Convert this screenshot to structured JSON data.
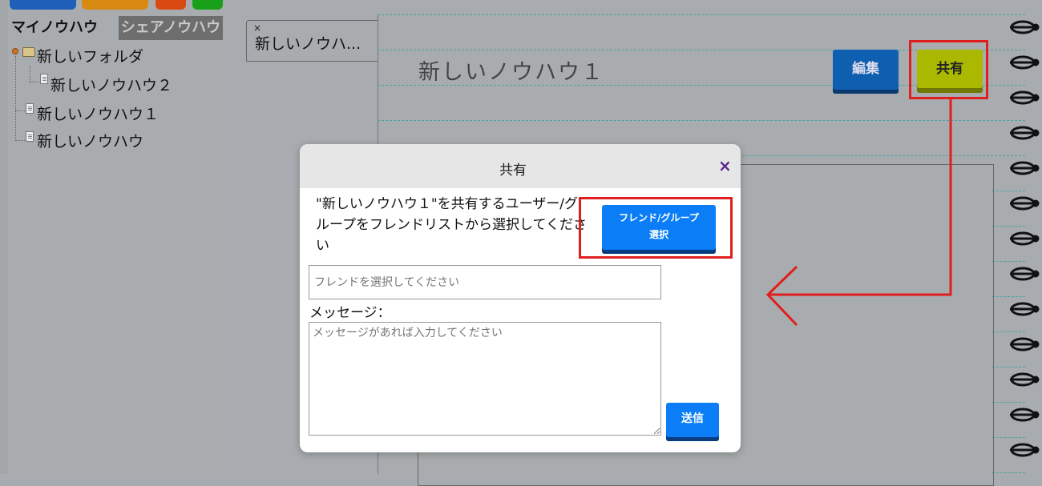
{
  "sidebar": {
    "tabs": {
      "my": "マイノウハウ",
      "shared": "シェアノウハウ"
    },
    "tree": {
      "folder_label": "新しいフォルダ",
      "child_label": "新しいノウハウ２",
      "item1_label": "新しいノウハウ１",
      "item2_label": "新しいノウハウ"
    },
    "top_button_colors": [
      "#1f5fb8",
      "#d88a10",
      "#d84a10",
      "#19a019"
    ]
  },
  "document_tab": {
    "label": "新しいノウハ...",
    "close": "×"
  },
  "note": {
    "title": "新しいノウハウ１",
    "edit_label": "編集",
    "share_label": "共有"
  },
  "modal": {
    "title": "共有",
    "close": "×",
    "description": "\"新しいノウハウ１\"を共有するユーザー/グループをフレンドリストから選択してください",
    "friend_button_line1": "フレンド/グループ",
    "friend_button_line2": "選択",
    "friend_input_placeholder": "フレンドを選択してください",
    "message_label": "メッセージ：",
    "message_placeholder": "メッセージがあれば入力してください",
    "send_label": "送信"
  },
  "colors": {
    "annotation": "#e01e1e",
    "primary_button": "#0a7df7",
    "edit_button": "#0f5fb0",
    "share_button": "#aab800"
  }
}
